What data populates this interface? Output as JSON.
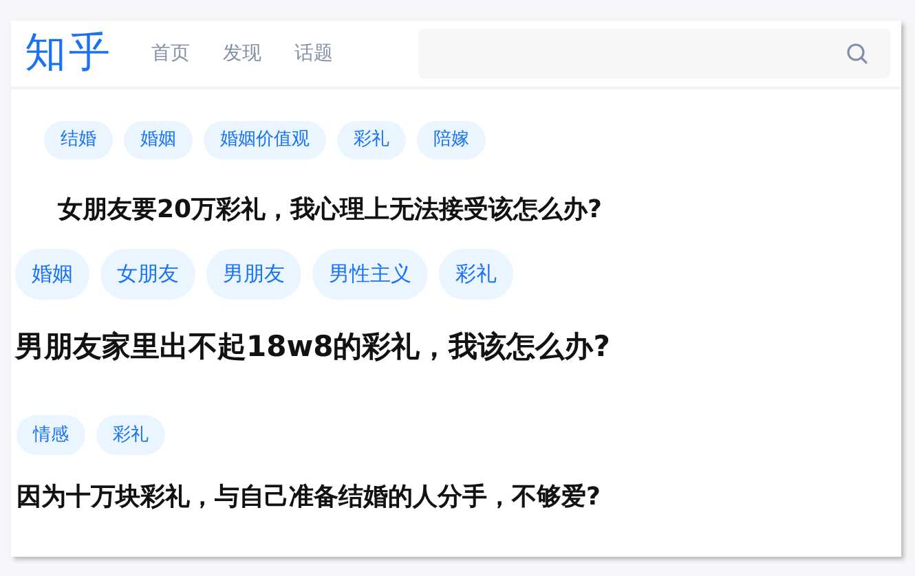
{
  "header": {
    "logo": "知乎",
    "nav": [
      "首页",
      "发现",
      "话题"
    ]
  },
  "questions": [
    {
      "tags": [
        "结婚",
        "婚姻",
        "婚姻价值观",
        "彩礼",
        "陪嫁"
      ],
      "title": "女朋友要20万彩礼，我心理上无法接受该怎么办?"
    },
    {
      "tags": [
        "婚姻",
        "女朋友",
        "男朋友",
        "男性主义",
        "彩礼"
      ],
      "title": "男朋友家里出不起18w8的彩礼，我该怎么办?"
    },
    {
      "tags": [
        "情感",
        "彩礼"
      ],
      "title": "因为十万块彩礼，与自己准备结婚的人分手，不够爱?"
    }
  ]
}
